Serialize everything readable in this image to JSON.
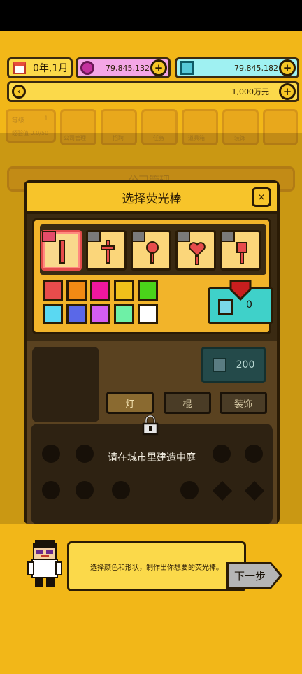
{
  "hud": {
    "date": "0年,1月",
    "pink_currency": "79,845,132",
    "teal_currency": "79,845,182",
    "money": "1,000万元"
  },
  "background": {
    "level_label": "等级",
    "level_value": "1",
    "exp_label": "经验值 0.0/50",
    "tab_labels": [
      "公司管理",
      "招聘",
      "任务",
      "道具箱",
      "装饰"
    ],
    "section_title": "公司管理"
  },
  "modal": {
    "title": "选择荧光棒",
    "close_label": "×",
    "shapes": [
      {
        "name": "straight-stick",
        "selected": true,
        "tag": "red"
      },
      {
        "name": "cross-stick",
        "selected": false,
        "tag": "gray"
      },
      {
        "name": "round-stick",
        "selected": false,
        "tag": "gray"
      },
      {
        "name": "heart-stick",
        "selected": false,
        "tag": "gray"
      },
      {
        "name": "square-stick",
        "selected": false,
        "tag": "gray"
      }
    ],
    "colors": [
      "#e84c4c",
      "#f28a14",
      "#f017a0",
      "#f0c01a",
      "#4ad41a",
      "#5ad8f2",
      "#5a68e8",
      "#d45ef2",
      "#6ef0a6",
      "#ffffff"
    ],
    "cost_value": "0",
    "price_value": "200",
    "tabs": [
      {
        "label": "灯",
        "active": true
      },
      {
        "label": "棍",
        "active": false
      },
      {
        "label": "装饰",
        "active": false
      }
    ],
    "lock_message": "请在城市里建造中庭"
  },
  "tutorial": {
    "dialog_text": "选择颜色和形状，制作出你想要的荧光棒。",
    "next_label": "下一步"
  }
}
